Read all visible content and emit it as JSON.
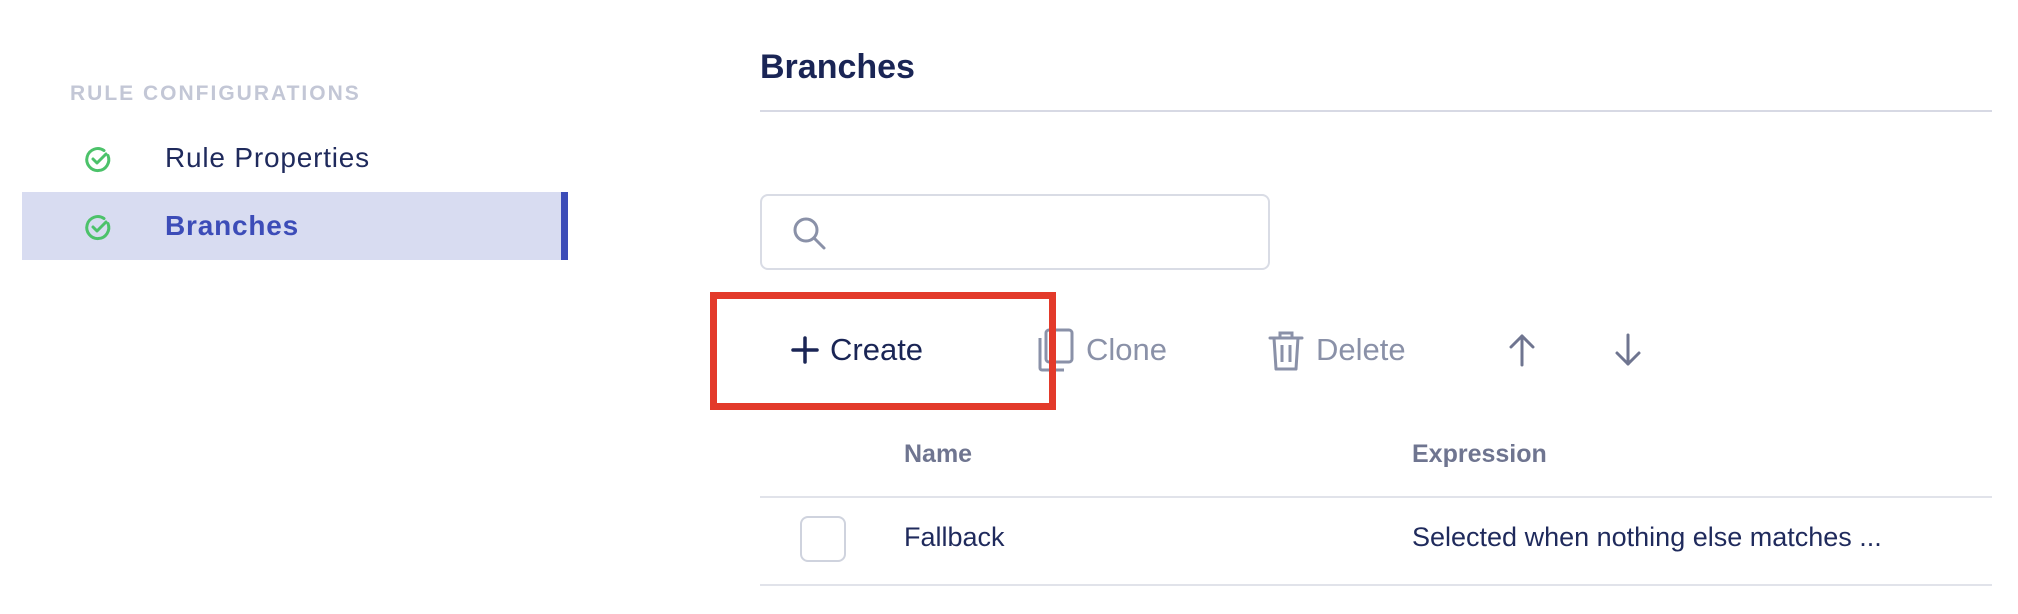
{
  "sidebar": {
    "heading": "RULE CONFIGURATIONS",
    "items": [
      {
        "label": "Rule Properties",
        "status_icon": "check-circle-icon",
        "active": false
      },
      {
        "label": "Branches",
        "status_icon": "check-circle-icon",
        "active": true
      }
    ]
  },
  "main": {
    "title": "Branches",
    "search": {
      "placeholder": "",
      "icon": "search-icon"
    },
    "toolbar": {
      "create_label": "Create",
      "clone_label": "Clone",
      "delete_label": "Delete",
      "move_up_icon": "arrow-up-icon",
      "move_down_icon": "arrow-down-icon"
    },
    "table": {
      "columns": [
        "Name",
        "Expression"
      ],
      "rows": [
        {
          "name": "Fallback",
          "expression": "Selected when nothing else matches ..."
        }
      ]
    }
  },
  "colors": {
    "accent": "#3c4cb8",
    "active_bg": "#d8dcf1",
    "highlight": "#e33a2a",
    "check_green": "#4cc26a",
    "text_dark": "#1a2555",
    "muted": "#8a91a8"
  }
}
